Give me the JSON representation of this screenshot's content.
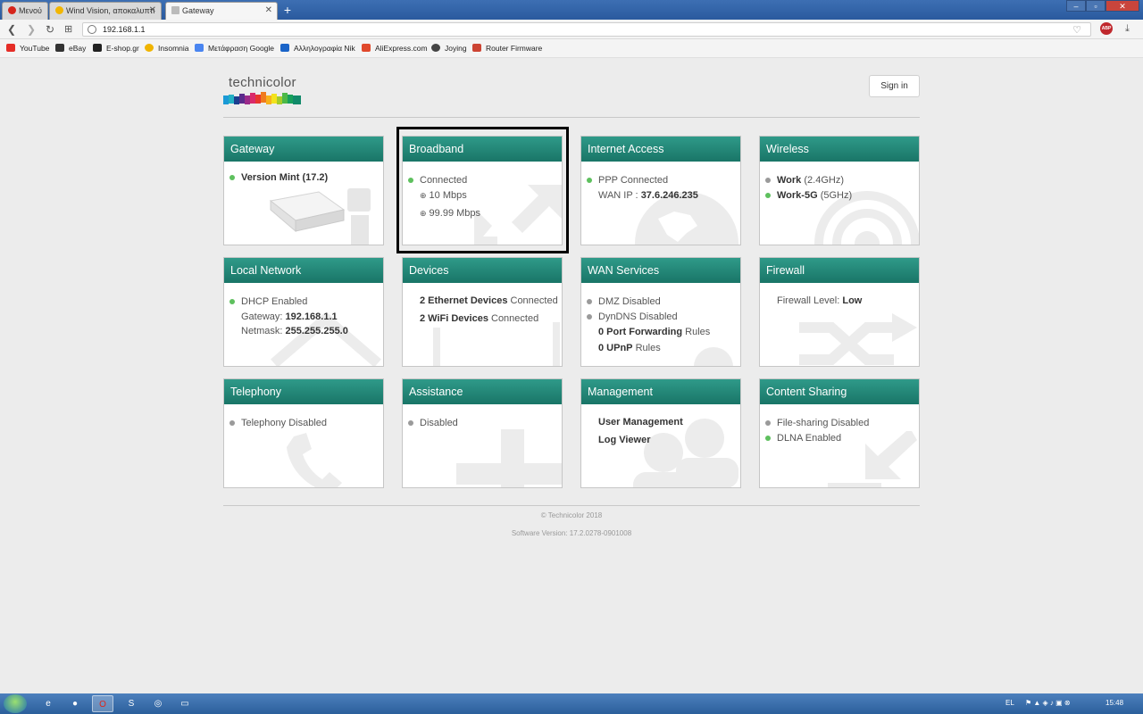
{
  "browser": {
    "tabs": [
      {
        "label": "Μενού"
      },
      {
        "label": "Wind Vision, αποκαλυπτι"
      },
      {
        "label": "Gateway"
      }
    ],
    "url": "192.168.1.1",
    "bookmarks": [
      {
        "label": "YouTube",
        "color": "#e52d27"
      },
      {
        "label": "eBay",
        "color": "#333333"
      },
      {
        "label": "E-shop.gr",
        "color": "#222222"
      },
      {
        "label": "Insomnia",
        "color": "#f0b400"
      },
      {
        "label": "Μετάφραση Google",
        "color": "#4a85f0"
      },
      {
        "label": "Αλληλογραφία Nik",
        "color": "#1a64c8"
      },
      {
        "label": "AliExpress.com",
        "color": "#e0492c"
      },
      {
        "label": "Joying",
        "color": "#444444"
      },
      {
        "label": "Router Firmware",
        "color": "#cc4433"
      }
    ]
  },
  "header": {
    "logo": "technicolor",
    "signin": "Sign in"
  },
  "cards": [
    {
      "title": "Gateway",
      "lines": [
        {
          "dot": "green",
          "bold": "Version Mint (17.2)",
          "text": ""
        }
      ]
    },
    {
      "title": "Broadband",
      "lines": [
        {
          "dot": "green",
          "text": "Connected"
        },
        {
          "icon": "upload-icon",
          "text": "10 Mbps"
        },
        {
          "icon": "download-icon",
          "text": "99.99 Mbps"
        }
      ]
    },
    {
      "title": "Internet Access",
      "lines": [
        {
          "dot": "green",
          "text": "PPP Connected"
        },
        {
          "text": "WAN IP : ",
          "bold": "37.6.246.235"
        }
      ]
    },
    {
      "title": "Wireless",
      "lines": [
        {
          "dot": "grey",
          "bold": "Work",
          "text": " (2.4GHz)"
        },
        {
          "dot": "green",
          "bold": "Work-5G",
          "text": " (5GHz)"
        }
      ]
    },
    {
      "title": "Local Network",
      "lines": [
        {
          "dot": "green",
          "text": "DHCP Enabled"
        },
        {
          "text": "Gateway: ",
          "bold": "192.168.1.1"
        },
        {
          "text": "Netmask: ",
          "bold": "255.255.255.0"
        }
      ]
    },
    {
      "title": "Devices",
      "lines": [
        {
          "bold": "2 Ethernet Devices",
          "text": " Connected"
        },
        {
          "bold": "2 WiFi Devices",
          "text": " Connected"
        }
      ]
    },
    {
      "title": "WAN Services",
      "lines": [
        {
          "dot": "grey",
          "text": "DMZ Disabled"
        },
        {
          "dot": "grey",
          "text": "DynDNS Disabled"
        },
        {
          "bold": "0 Port Forwarding",
          "text": " Rules"
        },
        {
          "bold": "0 UPnP",
          "text": " Rules"
        }
      ]
    },
    {
      "title": "Firewall",
      "lines": [
        {
          "text": "Firewall Level: ",
          "bold": "Low"
        }
      ]
    },
    {
      "title": "Telephony",
      "lines": [
        {
          "dot": "grey",
          "text": "Telephony Disabled"
        }
      ]
    },
    {
      "title": "Assistance",
      "lines": [
        {
          "dot": "grey",
          "text": "Disabled"
        }
      ]
    },
    {
      "title": "Management",
      "lines": [
        {
          "bold": "User Management",
          "text": ""
        },
        {
          "bold": "Log Viewer",
          "text": ""
        }
      ]
    },
    {
      "title": "Content Sharing",
      "lines": [
        {
          "dot": "grey",
          "text": "File-sharing Disabled"
        },
        {
          "dot": "green",
          "text": "DLNA Enabled"
        }
      ]
    }
  ],
  "footer": {
    "copyright": "© Technicolor 2018",
    "software": "Software Version: 17.2.0278-0901008"
  },
  "taskbar": {
    "language": "EL",
    "time": "15:48"
  }
}
